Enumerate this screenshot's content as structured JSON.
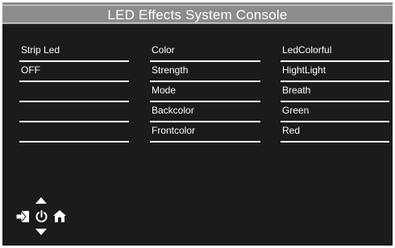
{
  "window": {
    "title": "LED Effects System Console"
  },
  "columns": {
    "left": [
      "Strip Led",
      "OFF",
      "",
      "",
      ""
    ],
    "middle": [
      "Color",
      "Strength",
      "Mode",
      "Backcolor",
      "Frontcolor"
    ],
    "right": [
      "LedColorful",
      "HightLight",
      "Breath",
      "Green",
      "Red"
    ]
  },
  "nav": {
    "icons": [
      "arrow-up-icon",
      "exit-icon",
      "power-icon",
      "home-icon",
      "arrow-down-icon"
    ]
  },
  "colors": {
    "background": "#1b1b1b",
    "title_bar": "#8c8c8c",
    "text": "#ffffff"
  }
}
